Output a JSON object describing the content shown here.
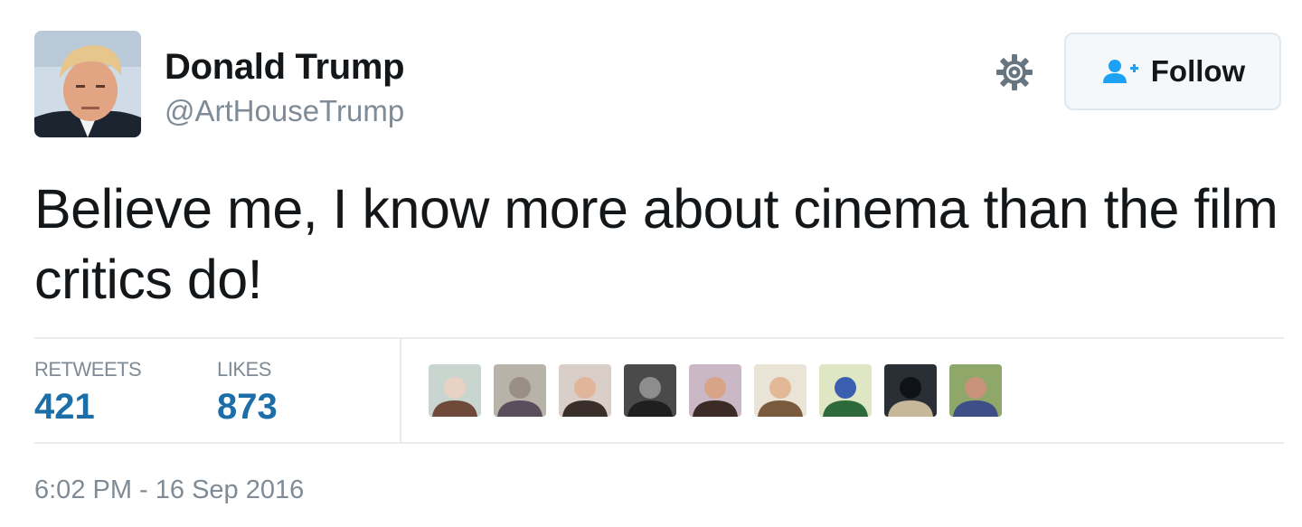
{
  "user": {
    "name": "Donald Trump",
    "handle": "@ArtHouseTrump",
    "avatar_icon": "profile-photo"
  },
  "actions": {
    "settings_icon": "gear-icon",
    "follow_icon": "add-user-icon",
    "follow_label": "Follow"
  },
  "tweet": {
    "text": "Believe me, I know more about cinema than the film critics do!"
  },
  "stats": {
    "retweets_label": "RETWEETS",
    "retweets_count": "421",
    "likes_label": "LIKES",
    "likes_count": "873"
  },
  "likers": [
    {
      "colors": [
        "#c9d6cf",
        "#6f4a3a",
        "#e8d2c4"
      ]
    },
    {
      "colors": [
        "#b8b3a8",
        "#5b4e5c",
        "#9a8f86"
      ]
    },
    {
      "colors": [
        "#d9cfc8",
        "#3a2e2a",
        "#e0b59a"
      ]
    },
    {
      "colors": [
        "#4a4a4a",
        "#1f1f1f",
        "#8d8d8d"
      ]
    },
    {
      "colors": [
        "#cbb8c6",
        "#3b2a26",
        "#d7a487"
      ]
    },
    {
      "colors": [
        "#e9e4d5",
        "#7a5a3c",
        "#e2b896"
      ]
    },
    {
      "colors": [
        "#dfe6c3",
        "#2c6a3b",
        "#3a5fb0"
      ]
    },
    {
      "colors": [
        "#2a2f35",
        "#c7b89a",
        "#0f1216"
      ]
    },
    {
      "colors": [
        "#8fa86a",
        "#3d4f86",
        "#c8937a"
      ]
    }
  ],
  "meta": {
    "timestamp": "6:02 PM - 16 Sep 2016"
  },
  "colors": {
    "link_blue": "#1b6ea8",
    "follow_icon_blue": "#1da1f2",
    "secondary_text": "#7f8b96",
    "divider": "#e6ecf0"
  }
}
